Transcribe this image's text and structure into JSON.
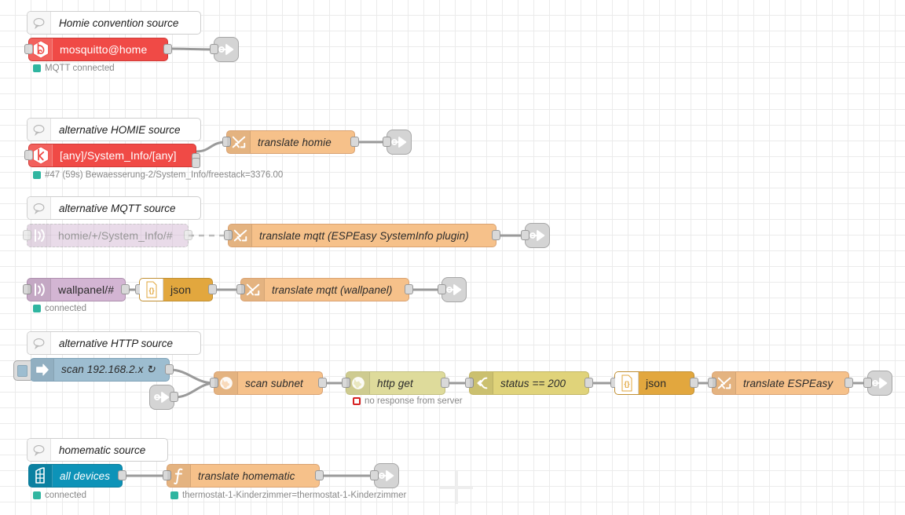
{
  "app": {
    "name": "Node-RED flow editor canvas",
    "grid_size": 20
  },
  "colors": {
    "mqtt_red": "#f04a46",
    "change_orange": "#f6c18a",
    "json_amber": "#e2a73e",
    "switch_yellow": "#e0d37a",
    "http_olive": "#dedb9b",
    "mqtt_in_mauve": "#d3b5d3",
    "inject_blue": "#9dbdd0",
    "homematic_teal": "#0d93b8",
    "debug_gray": "#d4d4d4",
    "status_green": "#2fb5a0",
    "status_red": "#d62121",
    "grid_line": "#ebebeb",
    "canvas_bg": "#ffffff"
  },
  "groups": [
    {
      "comment": "Homie convention source",
      "nodes": [
        {
          "label": "mosquitto@home",
          "type": "mqtt-in",
          "icon": "mosquitto-icon"
        },
        {
          "label": "",
          "type": "debug",
          "icon": "debug-icon"
        }
      ],
      "status": "MQTT connected",
      "status_state": "ok"
    },
    {
      "comment": "alternative HOMIE source",
      "nodes": [
        {
          "label": "[any]/System_Info/[any]",
          "type": "homie-in",
          "icon": "homie-icon"
        },
        {
          "label": "translate homie",
          "type": "change",
          "icon": "change-icon"
        },
        {
          "label": "",
          "type": "debug",
          "icon": "debug-icon"
        }
      ],
      "status": "#47 (59s) Bewaesserung-2/System_Info/freestack=3376.00",
      "status_state": "ok"
    },
    {
      "comment": "alternative MQTT source",
      "nodes": [
        {
          "label": "homie/+/System_Info/#",
          "type": "mqtt-in",
          "icon": "antenna-icon",
          "disabled": true
        },
        {
          "label": "translate mqtt (ESPEasy SystemInfo plugin)",
          "type": "change",
          "icon": "change-icon"
        },
        {
          "label": "",
          "type": "debug",
          "icon": "debug-icon"
        }
      ]
    },
    {
      "comment": "",
      "nodes": [
        {
          "label": "wallpanel/#",
          "type": "mqtt-in",
          "icon": "antenna-icon"
        },
        {
          "label": "json",
          "type": "json",
          "icon": "json-icon"
        },
        {
          "label": "translate mqtt (wallpanel)",
          "type": "change",
          "icon": "change-icon"
        },
        {
          "label": "",
          "type": "debug",
          "icon": "debug-icon"
        }
      ],
      "status": "connected",
      "status_state": "ok"
    },
    {
      "comment": "alternative HTTP source",
      "nodes": [
        {
          "label": "scan 192.168.2.x ↻",
          "type": "inject",
          "icon": "inject-arrow-icon"
        },
        {
          "label": "",
          "type": "link-in",
          "icon": "link-icon"
        },
        {
          "label": "scan subnet",
          "type": "http-request",
          "icon": "globe-icon"
        },
        {
          "label": "http get",
          "type": "http-request",
          "icon": "globe-icon"
        },
        {
          "label": "status == 200",
          "type": "switch",
          "icon": "switch-icon"
        },
        {
          "label": "json",
          "type": "json",
          "icon": "json-icon"
        },
        {
          "label": "translate ESPEasy",
          "type": "change",
          "icon": "change-icon"
        },
        {
          "label": "",
          "type": "debug",
          "icon": "debug-icon"
        }
      ],
      "status": "no response from server",
      "status_state": "error"
    },
    {
      "comment": "homematic source",
      "nodes": [
        {
          "label": "all devices",
          "type": "homematic",
          "icon": "building-icon"
        },
        {
          "label": "translate homematic",
          "type": "function",
          "icon": "function-icon"
        },
        {
          "label": "",
          "type": "debug",
          "icon": "debug-icon"
        }
      ],
      "status": "connected",
      "status_state": "ok",
      "status2": "thermostat-1-Kinderzimmer=thermostat-1-Kinderzimmer",
      "status2_state": "ok"
    }
  ],
  "comments": {
    "c1": "Homie convention source",
    "c2": "alternative HOMIE source",
    "c3": "alternative MQTT source",
    "c4": "alternative HTTP source",
    "c5": "homematic source"
  },
  "labels": {
    "mosquitto": "mosquitto@home",
    "homie_topic": "[any]/System_Info/[any]",
    "translate_homie": "translate homie",
    "mqtt_disabled_topic": "homie/+/System_Info/#",
    "translate_mqtt_espeasy": "translate mqtt (ESPEasy SystemInfo plugin)",
    "wallpanel_topic": "wallpanel/#",
    "json1": "json",
    "translate_mqtt_wallpanel": "translate mqtt (wallpanel)",
    "inject_scan": "scan 192.168.2.x ↻",
    "scan_subnet": "scan subnet",
    "http_get": "http get",
    "status_200": "status == 200",
    "json2": "json",
    "translate_espeasy": "translate ESPEasy",
    "all_devices": "all devices",
    "translate_homematic": "translate homematic"
  },
  "statuses": {
    "mqtt_connected": "MQTT connected",
    "homie_msg": "#47 (59s) Bewaesserung-2/System_Info/freestack=3376.00",
    "wallpanel_connected": "connected",
    "no_response": "no response from server",
    "homematic_connected": "connected",
    "homematic_msg": "thermostat-1-Kinderzimmer=thermostat-1-Kinderzimmer"
  }
}
